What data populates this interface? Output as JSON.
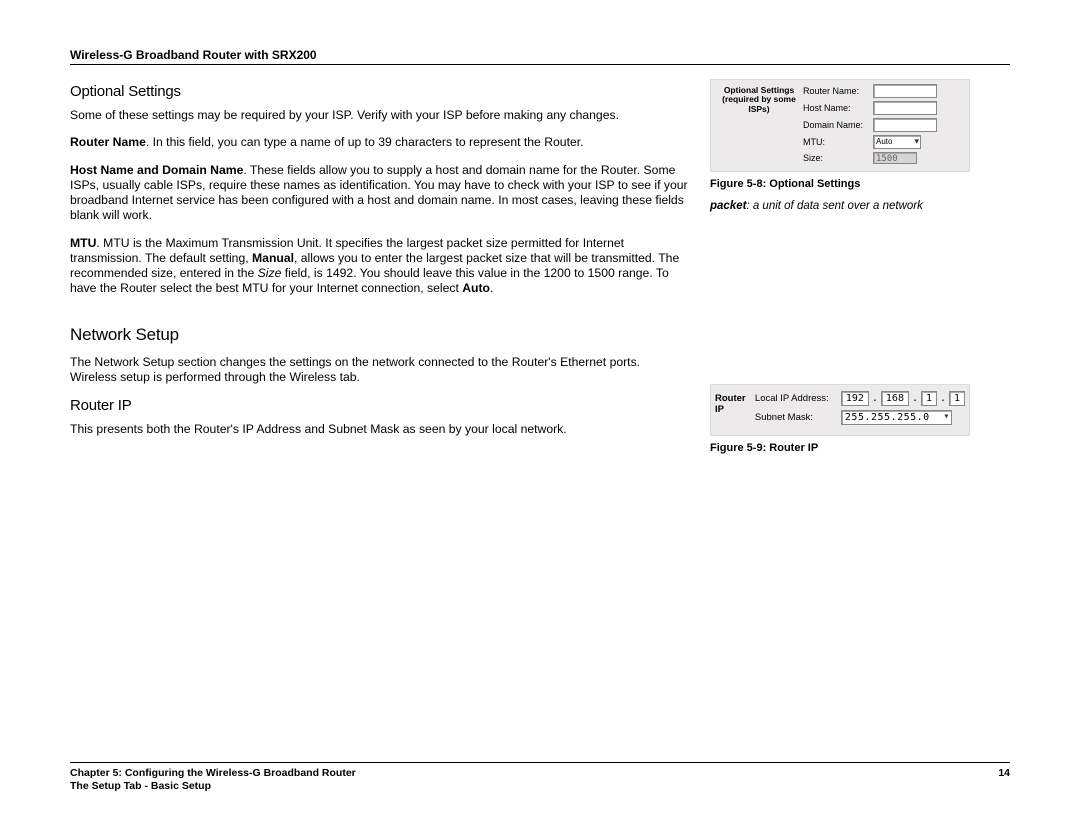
{
  "header": {
    "doc_title": "Wireless-G Broadband Router with SRX200"
  },
  "left": {
    "h_optional": "Optional Settings",
    "p_intro": "Some of these settings may be required by your ISP. Verify with your ISP before making any changes.",
    "p_router_name_b": "Router Name",
    "p_router_name_t": ". In this field, you can type a name of up to 39 characters to represent the Router.",
    "p_host_b": "Host Name and Domain Name",
    "p_host_t": ". These fields allow you to supply a host and domain name for the Router. Some ISPs, usually cable ISPs, require these names as identification. You may have to check with your ISP to see if your broadband Internet service has been configured with a host and domain name. In most cases, leaving these fields blank will work.",
    "p_mtu_b": "MTU",
    "p_mtu_t1": ". MTU is the Maximum Transmission Unit. It specifies the largest packet size permitted for Internet transmission. The default setting, ",
    "p_mtu_manual": "Manual",
    "p_mtu_t2": ", allows you to enter the largest packet size that will be transmitted. The recommended size, entered in the ",
    "p_mtu_size_i": "Size",
    "p_mtu_t3": " field, is 1492. You should leave this value in the 1200 to 1500 range. To have the Router select the best MTU for your Internet connection, select ",
    "p_mtu_auto": "Auto",
    "p_mtu_t4": ".",
    "h_network": "Network Setup",
    "p_network": "The Network Setup section changes the settings on the network connected to the Router's Ethernet ports. Wireless setup is performed through the Wireless tab.",
    "h_router_ip": "Router IP",
    "p_router_ip": "This presents both the Router's IP Address and Subnet Mask as seen by your local network."
  },
  "fig58": {
    "panel_title_l1": "Optional Settings",
    "panel_title_l2": "(required by some ISPs)",
    "router_name": "Router Name:",
    "host_name": "Host Name:",
    "domain_name": "Domain Name:",
    "mtu": "MTU:",
    "mtu_val": "Auto",
    "size": "Size:",
    "size_val": "1500",
    "caption": "Figure 5-8: Optional Settings"
  },
  "glossary": {
    "term": "packet",
    "def": ": a unit of data sent over a network"
  },
  "fig59": {
    "panel_title": "Router IP",
    "local_ip": "Local IP Address:",
    "ip1": "192",
    "ip2": "168",
    "ip3": "1",
    "ip4": "1",
    "subnet": "Subnet Mask:",
    "mask_val": "255.255.255.0",
    "caption": "Figure 5-9: Router IP"
  },
  "footer": {
    "chapter": "Chapter 5: Configuring the Wireless-G Broadband Router",
    "page": "14",
    "sub": "The Setup Tab - Basic Setup"
  }
}
